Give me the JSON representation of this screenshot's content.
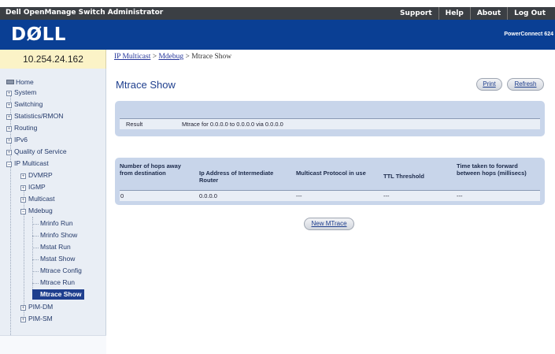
{
  "header": {
    "app_title": "Dell OpenManage Switch Administrator",
    "links": [
      "Support",
      "Help",
      "About",
      "Log Out"
    ],
    "logo_text": "DØLL",
    "product": "PowerConnect 624"
  },
  "ip_address": "10.254.24.162",
  "breadcrumb": {
    "items": [
      "IP Multicast",
      "Mdebug"
    ],
    "separator": " > ",
    "current": "Mtrace Show"
  },
  "sidebar": {
    "home": "Home",
    "top_items": [
      "System",
      "Switching",
      "Statistics/RMON",
      "Routing",
      "IPv6",
      "Quality of Service"
    ],
    "ip_multicast": "IP Multicast",
    "ip_multicast_children": [
      "DVMRP",
      "IGMP",
      "Multicast"
    ],
    "mdebug": "Mdebug",
    "mdebug_children": [
      "Mrinfo Run",
      "Mrinfo Show",
      "Mstat Run",
      "Mstat Show",
      "Mtrace Config",
      "Mtrace Run",
      "Mtrace Show"
    ],
    "after_mdebug": [
      "PIM-DM",
      "PIM-SM"
    ],
    "expander_collapsed": "+",
    "expander_expanded": "−"
  },
  "main": {
    "title": "Mtrace Show",
    "print_label": "Print",
    "refresh_label": "Refresh",
    "result": {
      "label": "Result",
      "value": "Mtrace for 0.0.0.0 to 0.0.0.0 via 0.0.0.0"
    },
    "table": {
      "columns": [
        "Number of hops away from destination",
        "Ip Address of Intermediate Router",
        "Multicast Protocol in use",
        "TTL Threshold",
        "Time taken to forward between hops (millisecs)"
      ],
      "rows": [
        [
          "0",
          "0.0.0.0",
          "---",
          "---",
          "---"
        ]
      ]
    },
    "new_mtrace_label": "New MTrace"
  },
  "colors": {
    "topbar": "#3b3f44",
    "banner": "#0a3f94",
    "ip_bar": "#fbf3c7",
    "sidebar": "#e9eef5",
    "panel": "#c8d5ea",
    "active_nav": "#1f3f8e"
  }
}
